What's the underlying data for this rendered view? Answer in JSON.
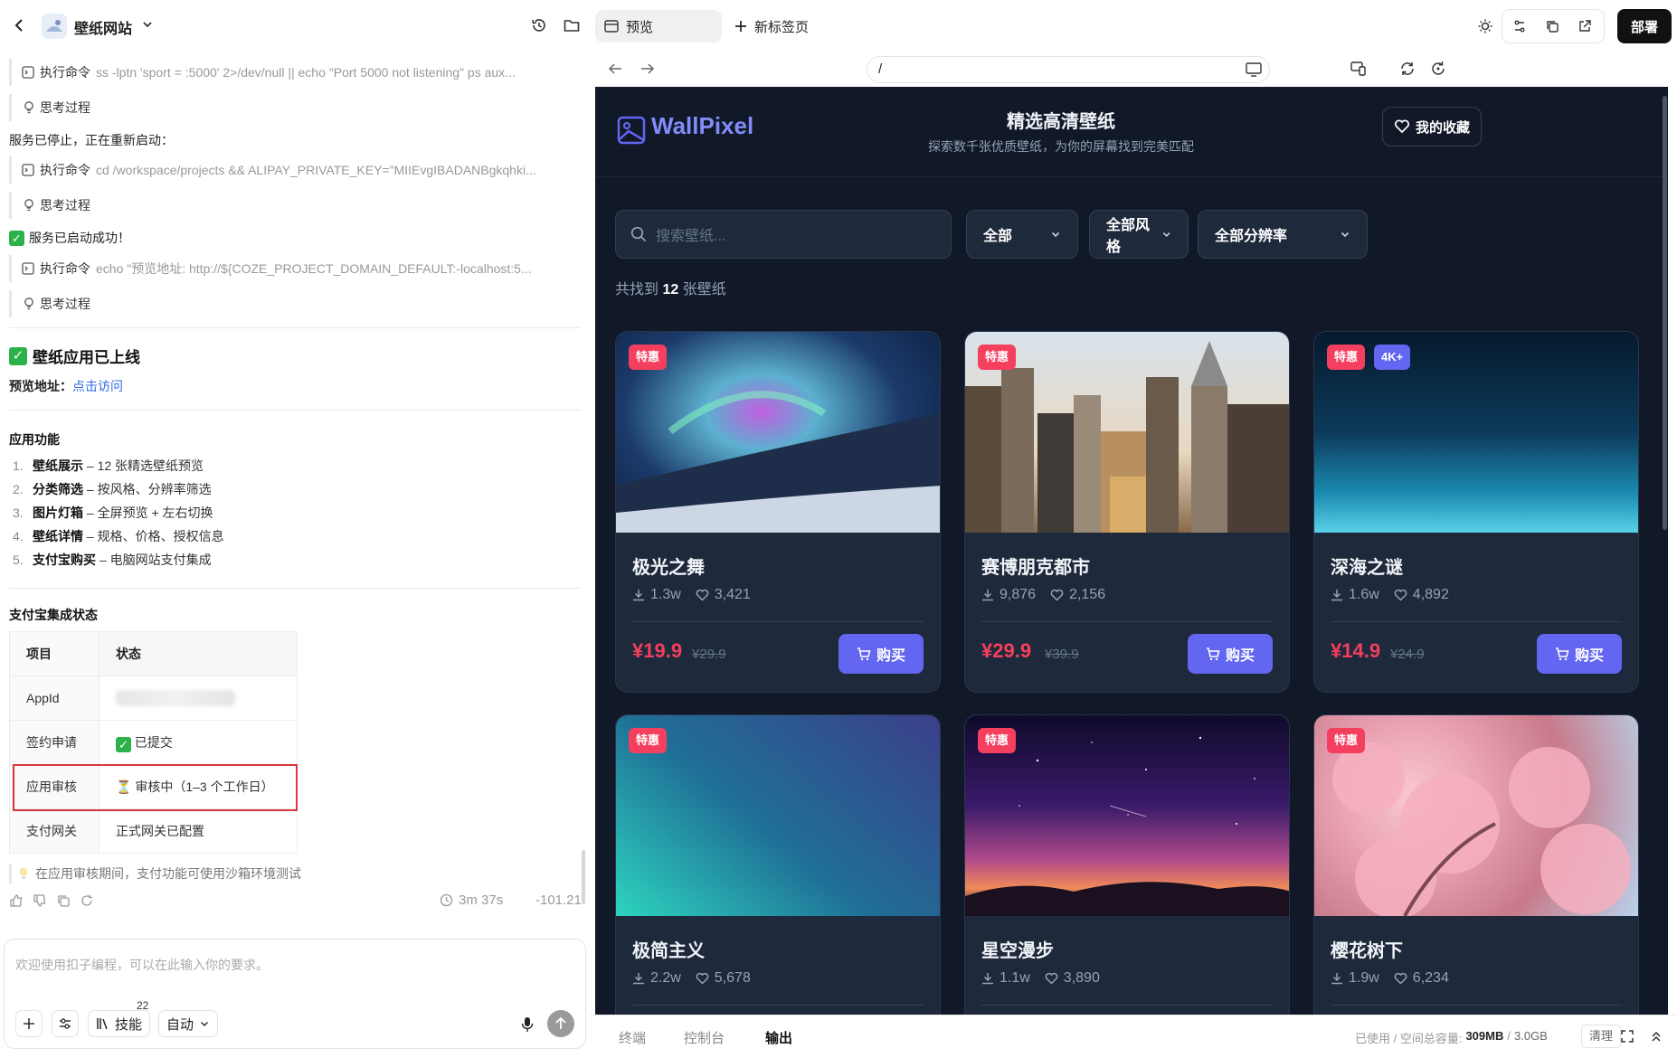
{
  "project": {
    "name": "壁纸网站"
  },
  "log": [
    {
      "type": "cmd",
      "label": "执行命令",
      "arg": "ss -lptn 'sport = :5000' 2>/dev/null || echo \"Port 5000 not listening\" ps aux..."
    },
    {
      "type": "think",
      "label": "思考过程"
    },
    {
      "type": "text",
      "text": "服务已停止，正在重新启动："
    },
    {
      "type": "cmd",
      "label": "执行命令",
      "arg": "cd /workspace/projects && ALIPAY_PRIVATE_KEY=\"MIIEvgIBADANBgkqhki..."
    },
    {
      "type": "think",
      "label": "思考过程"
    },
    {
      "type": "text",
      "text": "服务已启动成功！"
    },
    {
      "type": "cmd",
      "label": "执行命令",
      "arg": "echo \"预览地址: http://${COZE_PROJECT_DOMAIN_DEFAULT:-localhost:5..."
    },
    {
      "type": "think",
      "label": "思考过程"
    }
  ],
  "launch": {
    "title": "壁纸应用已上线",
    "preview_label": "预览地址：",
    "preview_link": "点击访问"
  },
  "features": {
    "heading": "应用功能",
    "items": [
      {
        "num": "1.",
        "name": "壁纸展示",
        "desc": " – 12 张精选壁纸预览"
      },
      {
        "num": "2.",
        "name": "分类筛选",
        "desc": " – 按风格、分辨率筛选"
      },
      {
        "num": "3.",
        "name": "图片灯箱",
        "desc": " – 全屏预览 + 左右切换"
      },
      {
        "num": "4.",
        "name": "壁纸详情",
        "desc": " – 规格、价格、授权信息"
      },
      {
        "num": "5.",
        "name": "支付宝购买",
        "desc": " – 电脑网站支付集成"
      }
    ]
  },
  "alipay": {
    "heading": "支付宝集成状态",
    "col_item": "项目",
    "col_status": "状态",
    "rows": [
      {
        "item": "AppId",
        "status": ""
      },
      {
        "item": "签约申请",
        "status": "已提交"
      },
      {
        "item": "应用审核",
        "status": "审核中（1–3 个工作日）"
      },
      {
        "item": "支付网关",
        "status": "正式网关已配置"
      }
    ]
  },
  "tip": "在应用审核期间，支付功能可使用沙箱环境测试",
  "meta": {
    "duration": "3m 37s",
    "credits": "-101.21"
  },
  "input": {
    "placeholder": "欢迎使用扣子编程，可以在此输入你的要求。",
    "skills_label": "技能",
    "skills_count": "22",
    "mode": "自动"
  },
  "tabs": {
    "preview": "预览",
    "new_tab": "新标签页",
    "deploy": "部署"
  },
  "addressbar": {
    "url": "/"
  },
  "site": {
    "brand": "WallPixel",
    "hero_title": "精选高清壁纸",
    "hero_sub": "探索数千张优质壁纸，为你的屏幕找到完美匹配",
    "fav": "我的收藏",
    "search_placeholder": "搜索壁纸...",
    "filter_all": "全部",
    "filter_style": "全部风格",
    "filter_res": "全部分辨率",
    "found_prefix": "共找到 ",
    "found_count": "12",
    "found_suffix": " 张壁纸",
    "buy_label": "购买",
    "cards": [
      {
        "title": "极光之舞",
        "downloads": "1.3w",
        "likes": "3,421",
        "price": "¥19.9",
        "old": "¥29.9",
        "badges": [
          "特惠"
        ]
      },
      {
        "title": "赛博朋克都市",
        "downloads": "9,876",
        "likes": "2,156",
        "price": "¥29.9",
        "old": "¥39.9",
        "badges": [
          "特惠"
        ]
      },
      {
        "title": "深海之谜",
        "downloads": "1.6w",
        "likes": "4,892",
        "price": "¥14.9",
        "old": "¥24.9",
        "badges": [
          "特惠",
          "4K+"
        ]
      },
      {
        "title": "极简主义",
        "downloads": "2.2w",
        "likes": "5,678",
        "badges": [
          "特惠"
        ]
      },
      {
        "title": "星空漫步",
        "downloads": "1.1w",
        "likes": "3,890",
        "badges": [
          "特惠"
        ]
      },
      {
        "title": "樱花树下",
        "downloads": "1.9w",
        "likes": "6,234",
        "badges": [
          "特惠"
        ]
      }
    ]
  },
  "bottom": {
    "tabs": [
      "终端",
      "控制台",
      "输出"
    ],
    "storage_label": "已使用 / 空间总容量:",
    "used": "309MB",
    "total": "3.0GB",
    "clean": "清理"
  },
  "colors": {
    "accent": "#6366f1",
    "price": "#f43f5e",
    "badge_sale": "#f43f5e",
    "badge_4k": "#6366f1",
    "preview_bg": "#111827"
  }
}
